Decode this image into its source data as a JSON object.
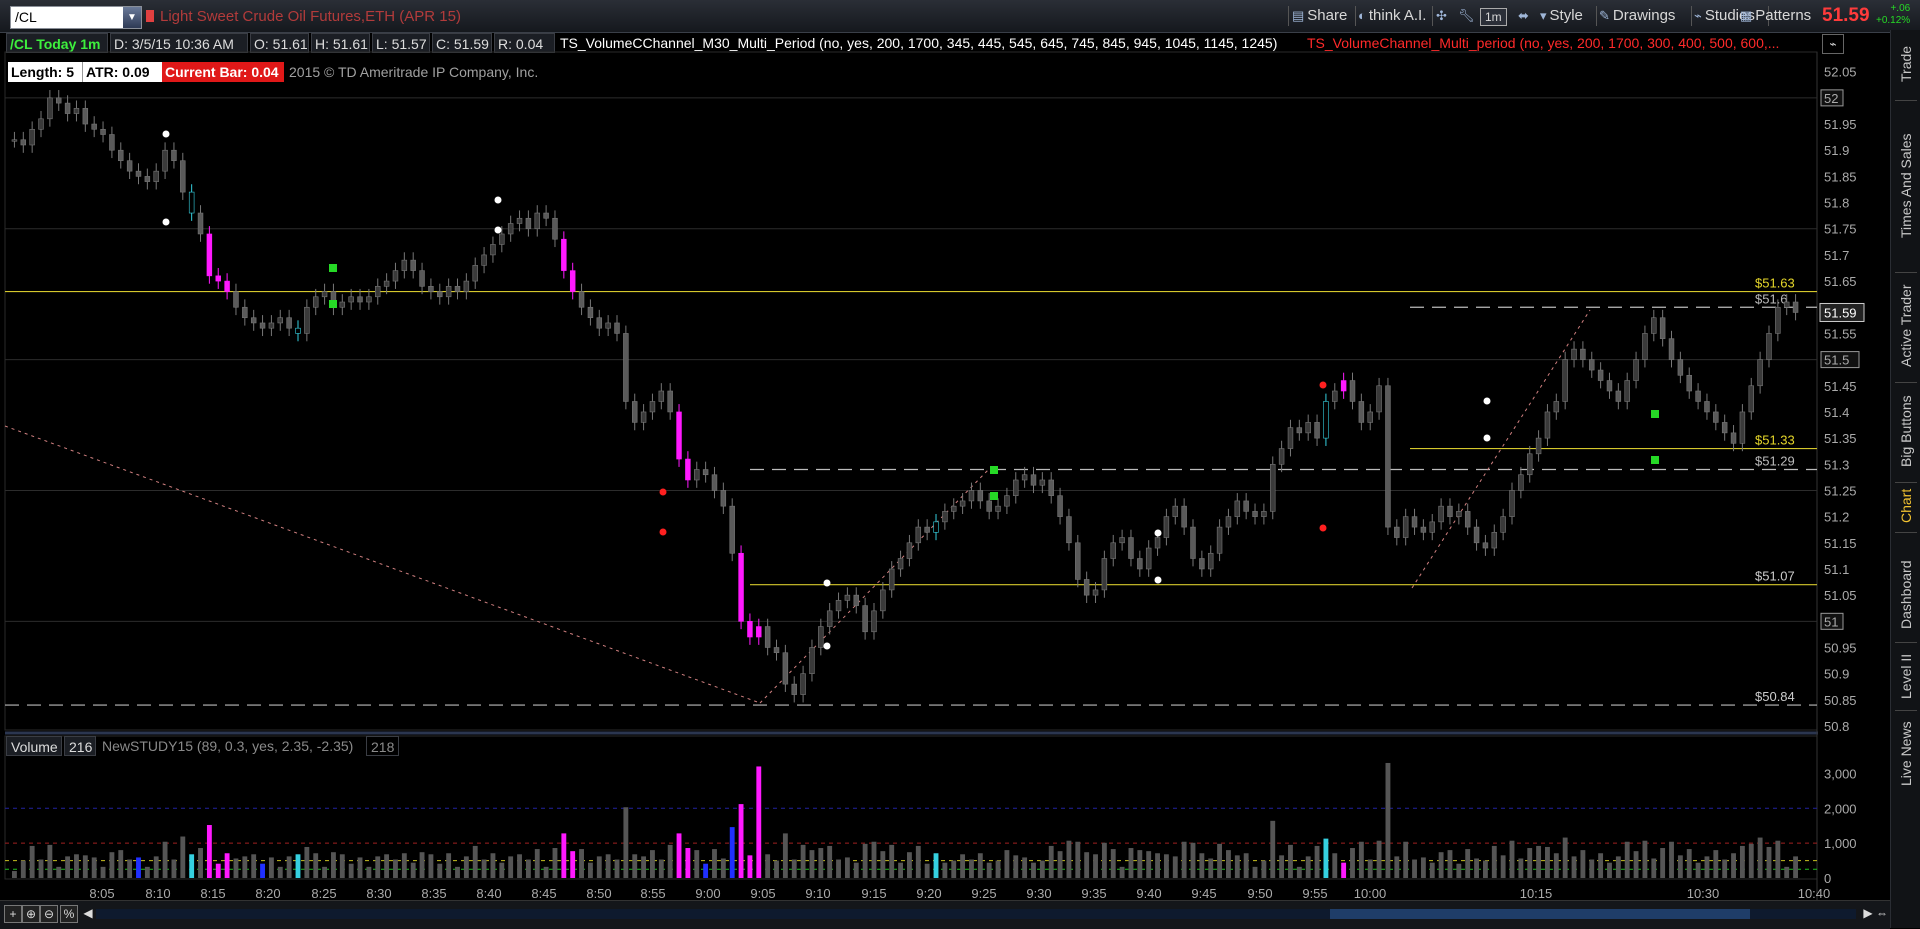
{
  "topbar": {
    "symbol": "/CL",
    "description": "Light Sweet Crude Oil Futures,ETH (APR 15)",
    "tools": [
      {
        "label": "Share",
        "icon": "share-icon"
      },
      {
        "label": "think A.I.",
        "icon": "thinkai-icon"
      },
      {
        "label": "1m",
        "icon": "timeframe"
      },
      {
        "label": "Style",
        "icon": "style-icon"
      },
      {
        "label": "Drawings",
        "icon": "drawings-icon"
      },
      {
        "label": "Studies",
        "icon": "studies-icon"
      },
      {
        "label": "Patterns",
        "icon": "patterns-icon"
      }
    ],
    "last_price": "51.59",
    "change_abs": "+.06",
    "change_pct": "+0.12%"
  },
  "infobar": {
    "period": "/CL Today 1m",
    "datetime": "D: 3/5/15 10:36 AM",
    "open": "O: 51.61",
    "high": "H: 51.61",
    "low": "L: 51.57",
    "close": "C: 51.59",
    "range": "R: 0.04",
    "study1": "TS_VolumeCChannel_M30_Multi_Period (no, yes, 200, 1700, 345, 445, 545, 645, 745, 845, 945, 1045, 1145, 1245)",
    "study2": "TS_VolumeChannel_Multi_period (no, yes, 200, 1700, 300, 400, 500, 600,..."
  },
  "legend": {
    "length": "Length: 5",
    "atr": "ATR: 0.09",
    "current_bar": "Current Bar: 0.04",
    "copyright": "2015 © TD Ameritrade IP Company, Inc."
  },
  "price_axis": {
    "ticks": [
      "52.05",
      "52",
      "51.95",
      "51.9",
      "51.85",
      "51.8",
      "51.75",
      "51.7",
      "51.65",
      "51.6",
      "51.55",
      "51.5",
      "51.45",
      "51.4",
      "51.35",
      "51.3",
      "51.25",
      "51.2",
      "51.15",
      "51.1",
      "51.05",
      "51",
      "50.95",
      "50.9",
      "50.85",
      "50.8"
    ],
    "boxed": [
      "52",
      "51.59",
      "51.5",
      "51"
    ],
    "current": "51.59"
  },
  "level_labels": [
    {
      "text": "$51.63",
      "price": 51.63,
      "color": "#e6d72a"
    },
    {
      "text": "$51.6",
      "price": 51.6,
      "color": "#bbbbbb"
    },
    {
      "text": "$51.33",
      "price": 51.33,
      "color": "#e6d72a"
    },
    {
      "text": "$51.29",
      "price": 51.29,
      "color": "#bbbbbb"
    },
    {
      "text": "$51.07",
      "price": 51.07,
      "color": "#cccccc"
    },
    {
      "text": "$50.84",
      "price": 50.84,
      "color": "#cccccc"
    }
  ],
  "time_axis": [
    "8:05",
    "8:10",
    "8:15",
    "8:20",
    "8:25",
    "8:30",
    "8:35",
    "8:40",
    "8:45",
    "8:50",
    "8:55",
    "9:00",
    "9:05",
    "9:10",
    "9:15",
    "9:20",
    "9:25",
    "9:30",
    "9:35",
    "9:40",
    "9:45",
    "9:50",
    "9:55",
    "10:00",
    "10:15",
    "10:30",
    "10:40"
  ],
  "volume_pane": {
    "label": "Volume",
    "value": "216",
    "study": "NewSTUDY15 (89, 0.3, yes, 2.35, -2.35)",
    "study_value": "218",
    "ticks": [
      "3,000",
      "2,000",
      "1,000",
      "0"
    ]
  },
  "side_tabs": [
    "Trade",
    "Times And Sales",
    "Active Trader",
    "Big Buttons",
    "Chart",
    "Dashboard",
    "Level II",
    "Live News"
  ],
  "active_side_tab": "Chart",
  "bottom_buttons": [
    "+",
    "⊕",
    "⊖",
    "%"
  ],
  "colors": {
    "bull": "#3a3a3a",
    "bear": "#5a5a5a",
    "magenta": "#ff19ff",
    "cyan": "#35d0e0",
    "yellow_line": "#d4c72c",
    "price_red": "#ff3b3b",
    "green": "#26d926"
  },
  "chart_data": {
    "type": "candlestick",
    "symbol": "/CL",
    "interval": "1m",
    "ylim": [
      50.8,
      52.08
    ],
    "closes": [
      51.92,
      51.91,
      51.94,
      51.96,
      52.0,
      51.99,
      51.97,
      51.98,
      51.95,
      51.94,
      51.93,
      51.9,
      51.88,
      51.86,
      51.85,
      51.84,
      51.86,
      51.9,
      51.88,
      51.82,
      51.78,
      51.74,
      51.66,
      51.65,
      51.63,
      51.6,
      51.58,
      51.57,
      51.56,
      51.57,
      51.58,
      51.56,
      51.55,
      51.6,
      51.62,
      51.63,
      51.6,
      51.61,
      51.62,
      51.61,
      51.62,
      51.64,
      51.65,
      51.67,
      51.69,
      51.67,
      51.64,
      51.63,
      51.62,
      51.64,
      51.63,
      51.65,
      51.68,
      51.7,
      51.72,
      51.74,
      51.76,
      51.77,
      51.75,
      51.78,
      51.77,
      51.73,
      51.67,
      51.63,
      51.6,
      51.58,
      51.56,
      51.57,
      51.55,
      51.42,
      51.38,
      51.4,
      51.42,
      51.44,
      51.4,
      51.31,
      51.27,
      51.29,
      51.28,
      51.25,
      51.22,
      51.13,
      51.0,
      50.97,
      50.99,
      50.95,
      50.94,
      50.88,
      50.86,
      50.9,
      50.95,
      50.99,
      51.02,
      51.04,
      51.05,
      51.03,
      50.98,
      51.02,
      51.06,
      51.1,
      51.12,
      51.15,
      51.18,
      51.17,
      51.19,
      51.21,
      51.22,
      51.23,
      51.25,
      51.23,
      51.21,
      51.22,
      51.24,
      51.27,
      51.28,
      51.26,
      51.27,
      51.24,
      51.2,
      51.15,
      51.08,
      51.05,
      51.06,
      51.12,
      51.15,
      51.16,
      51.12,
      51.1,
      51.14,
      51.16,
      51.2,
      51.22,
      51.18,
      51.12,
      51.1,
      51.13,
      51.18,
      51.2,
      51.23,
      51.21,
      51.2,
      51.21,
      51.3,
      51.33,
      51.37,
      51.36,
      51.38,
      51.35,
      51.42,
      51.44,
      51.46,
      51.42,
      51.38,
      51.4,
      51.45,
      51.18,
      51.16,
      51.2,
      51.18,
      51.17,
      51.19,
      51.22,
      51.2,
      51.21,
      51.18,
      51.15,
      51.14,
      51.17,
      51.2,
      51.25,
      51.28,
      51.32,
      51.35,
      51.4,
      51.42,
      51.5,
      51.52,
      51.5,
      51.48,
      51.46,
      51.44,
      51.42,
      51.46,
      51.5,
      51.55,
      51.58,
      51.54,
      51.5,
      51.47,
      51.44,
      51.42,
      51.4,
      51.38,
      51.36,
      51.34,
      51.4,
      51.45,
      51.5,
      51.55,
      51.6,
      51.61,
      51.59
    ]
  }
}
